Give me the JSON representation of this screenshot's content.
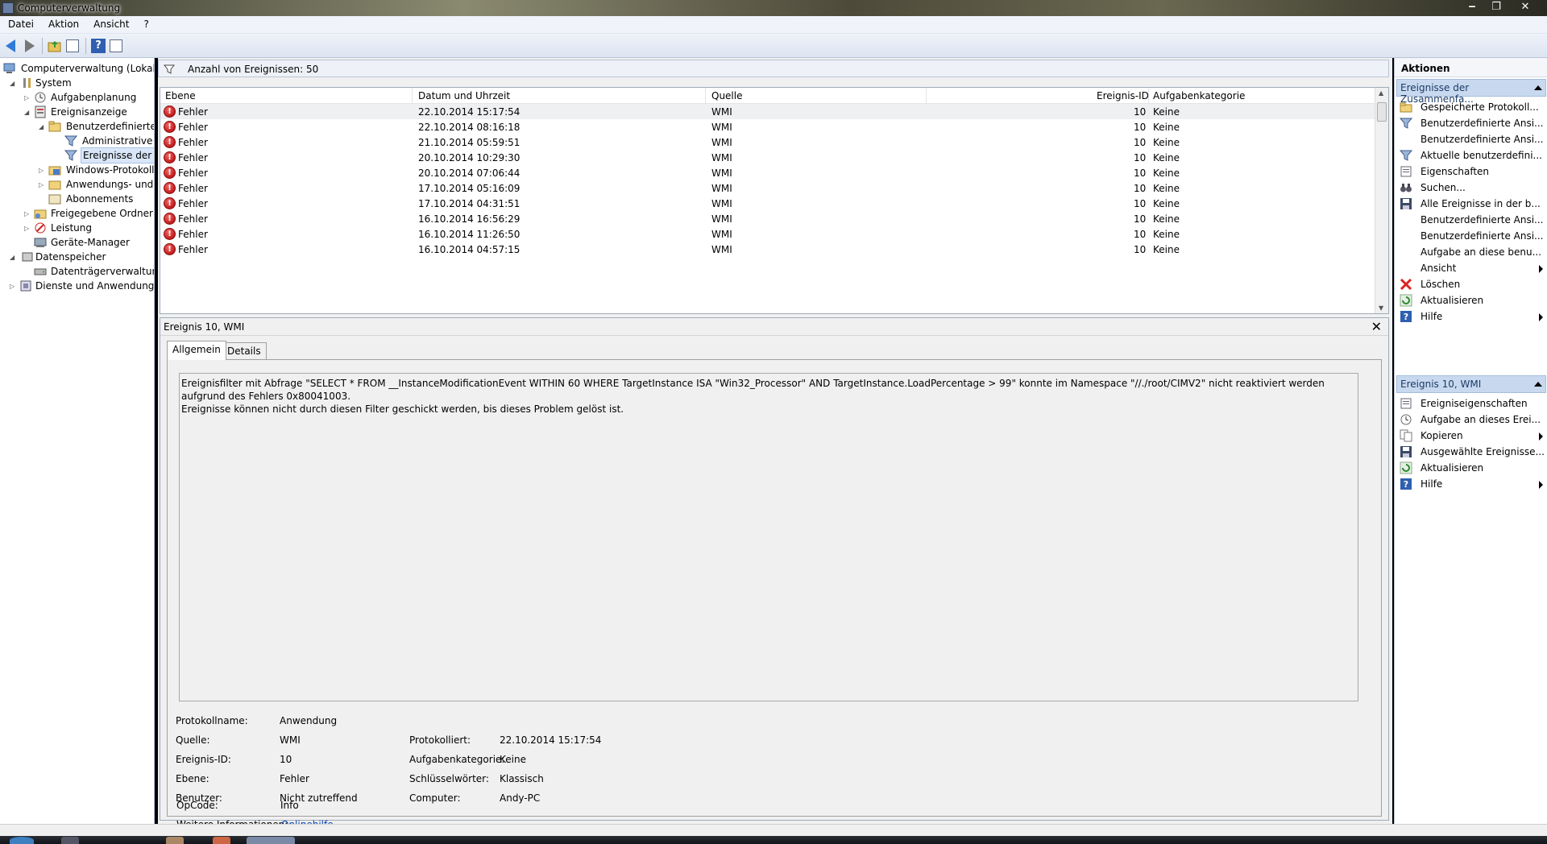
{
  "window": {
    "title": "Computerverwaltung"
  },
  "menu": [
    "Datei",
    "Aktion",
    "Ansicht",
    "?"
  ],
  "tree": [
    {
      "label": "Computerverwaltung (Lokal)",
      "icon": "computer-icon"
    },
    {
      "label": "System",
      "icon": "tools-icon"
    },
    {
      "label": "Aufgabenplanung",
      "icon": "clock-icon"
    },
    {
      "label": "Ereignisanzeige",
      "icon": "event-viewer-icon"
    },
    {
      "label": "Benutzerdefinierte A",
      "icon": "folder-icon"
    },
    {
      "label": "Administrative E",
      "icon": "filter-icon"
    },
    {
      "label": "Ereignisse der Zu",
      "icon": "filter-icon"
    },
    {
      "label": "Windows-Protokolle",
      "icon": "log-icon"
    },
    {
      "label": "Anwendungs- und D",
      "icon": "log-icon"
    },
    {
      "label": "Abonnements",
      "icon": "subscription-icon"
    },
    {
      "label": "Freigegebene Ordner",
      "icon": "shared-folder-icon"
    },
    {
      "label": "Leistung",
      "icon": "performance-icon"
    },
    {
      "label": "Geräte-Manager",
      "icon": "device-manager-icon"
    },
    {
      "label": "Datenspeicher",
      "icon": "storage-icon"
    },
    {
      "label": "Datenträgerverwaltung",
      "icon": "disk-icon"
    },
    {
      "label": "Dienste und Anwendungen",
      "icon": "services-icon"
    }
  ],
  "list": {
    "count_label": "Anzahl von Ereignissen: 50",
    "columns": [
      "Ebene",
      "Datum und Uhrzeit",
      "Quelle",
      "Ereignis-ID",
      "Aufgabenkategorie"
    ],
    "rows": [
      [
        "Fehler",
        "22.10.2014 15:17:54",
        "WMI",
        "10",
        "Keine"
      ],
      [
        "Fehler",
        "22.10.2014 08:16:18",
        "WMI",
        "10",
        "Keine"
      ],
      [
        "Fehler",
        "21.10.2014 05:59:51",
        "WMI",
        "10",
        "Keine"
      ],
      [
        "Fehler",
        "20.10.2014 10:29:30",
        "WMI",
        "10",
        "Keine"
      ],
      [
        "Fehler",
        "20.10.2014 07:06:44",
        "WMI",
        "10",
        "Keine"
      ],
      [
        "Fehler",
        "17.10.2014 05:16:09",
        "WMI",
        "10",
        "Keine"
      ],
      [
        "Fehler",
        "17.10.2014 04:31:51",
        "WMI",
        "10",
        "Keine"
      ],
      [
        "Fehler",
        "16.10.2014 16:56:29",
        "WMI",
        "10",
        "Keine"
      ],
      [
        "Fehler",
        "16.10.2014 11:26:50",
        "WMI",
        "10",
        "Keine"
      ],
      [
        "Fehler",
        "16.10.2014 04:57:15",
        "WMI",
        "10",
        "Keine"
      ]
    ]
  },
  "detail": {
    "title": "Ereignis 10, WMI",
    "tabs": [
      "Allgemein",
      "Details"
    ],
    "description_line1": "Ereignisfilter mit Abfrage \"SELECT * FROM __InstanceModificationEvent WITHIN 60 WHERE TargetInstance ISA \"Win32_Processor\" AND TargetInstance.LoadPercentage > 99\" konnte im Namespace \"//./root/CIMV2\" nicht reaktiviert werden aufgrund des Fehlers 0x80041003.",
    "description_line2": "Ereignisse können nicht durch diesen Filter geschickt werden, bis dieses Problem gelöst ist.",
    "props": {
      "protokollname_label": "Protokollname:",
      "protokollname": "Anwendung",
      "quelle_label": "Quelle:",
      "quelle": "WMI",
      "protokolliert_label": "Protokolliert:",
      "protokolliert": "22.10.2014 15:17:54",
      "ereignis_id_label": "Ereignis-ID:",
      "ereignis_id": "10",
      "aufgabenkategorie_label": "Aufgabenkategorie:",
      "aufgabenkategorie": "Keine",
      "ebene_label": "Ebene:",
      "ebene": "Fehler",
      "schluesselwoerter_label": "Schlüsselwörter:",
      "schluesselwoerter": "Klassisch",
      "benutzer_label": "Benutzer:",
      "benutzer": "Nicht zutreffend",
      "computer_label": "Computer:",
      "computer": "Andy-PC",
      "opcode_label": "OpCode:",
      "opcode": "Info",
      "weitere_label": "Weitere Informationen:",
      "weitere_link": "Onlinehilfe"
    }
  },
  "actions": {
    "title": "Aktionen",
    "section1": "Ereignisse der Zusammenfa...",
    "section1_items": [
      {
        "label": "Gespeicherte Protokoll...",
        "icon": "open-folder-icon",
        "submenu": false
      },
      {
        "label": "Benutzerdefinierte Ansi...",
        "icon": "filter-icon",
        "submenu": false
      },
      {
        "label": "Benutzerdefinierte Ansi...",
        "icon": "",
        "submenu": false
      },
      {
        "label": "Aktuelle benutzerdefini...",
        "icon": "filter-icon",
        "submenu": false
      },
      {
        "label": "Eigenschaften",
        "icon": "properties-icon",
        "submenu": false
      },
      {
        "label": "Suchen...",
        "icon": "binoculars-icon",
        "submenu": false
      },
      {
        "label": "Alle Ereignisse in der b...",
        "icon": "save-icon",
        "submenu": false
      },
      {
        "label": "Benutzerdefinierte Ansi...",
        "icon": "",
        "submenu": false
      },
      {
        "label": "Benutzerdefinierte Ansi...",
        "icon": "",
        "submenu": false
      },
      {
        "label": "Aufgabe an diese benu...",
        "icon": "",
        "submenu": false
      },
      {
        "label": "Ansicht",
        "icon": "",
        "submenu": true
      },
      {
        "label": "Löschen",
        "icon": "delete-icon",
        "submenu": false
      },
      {
        "label": "Aktualisieren",
        "icon": "refresh-icon",
        "submenu": false
      },
      {
        "label": "Hilfe",
        "icon": "help-icon",
        "submenu": true
      }
    ],
    "section2": "Ereignis 10, WMI",
    "section2_items": [
      {
        "label": "Ereigniseigenschaften",
        "icon": "properties-icon",
        "submenu": false
      },
      {
        "label": "Aufgabe an dieses Erei...",
        "icon": "task-icon",
        "submenu": false
      },
      {
        "label": "Kopieren",
        "icon": "copy-icon",
        "submenu": true
      },
      {
        "label": "Ausgewählte Ereignisse...",
        "icon": "save-icon",
        "submenu": false
      },
      {
        "label": "Aktualisieren",
        "icon": "refresh-icon",
        "submenu": false
      },
      {
        "label": "Hilfe",
        "icon": "help-icon",
        "submenu": true
      }
    ]
  },
  "colors": {
    "selection": "#d9e6f8",
    "section_header": "#c8d9ef",
    "error": "#c21a1a",
    "link": "#0645ad"
  }
}
